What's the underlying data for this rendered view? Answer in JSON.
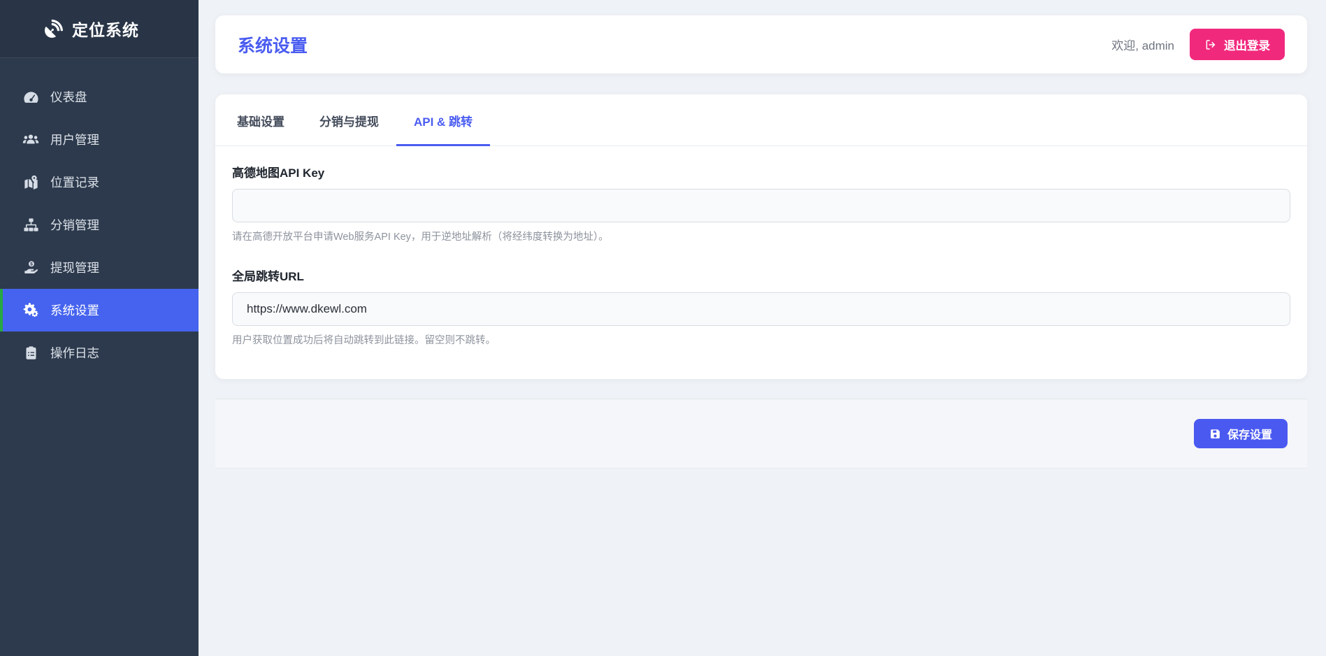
{
  "app": {
    "name": "定位系统",
    "logo_icon": "satellite-dish-icon"
  },
  "sidebar": {
    "items": [
      {
        "label": "仪表盘",
        "icon": "gauge-icon",
        "active": false
      },
      {
        "label": "用户管理",
        "icon": "users-icon",
        "active": false
      },
      {
        "label": "位置记录",
        "icon": "map-marked-icon",
        "active": false
      },
      {
        "label": "分销管理",
        "icon": "sitemap-icon",
        "active": false
      },
      {
        "label": "提现管理",
        "icon": "hand-dollar-icon",
        "active": false
      },
      {
        "label": "系统设置",
        "icon": "gears-icon",
        "active": true
      },
      {
        "label": "操作日志",
        "icon": "clipboard-list-icon",
        "active": false
      }
    ]
  },
  "header": {
    "title": "系统设置",
    "welcome": "欢迎, admin",
    "logout_label": "退出登录",
    "logout_icon": "sign-out-icon"
  },
  "tabs": [
    {
      "label": "基础设置",
      "active": false
    },
    {
      "label": "分销与提现",
      "active": false
    },
    {
      "label": "API & 跳转",
      "active": true
    }
  ],
  "form": {
    "amap": {
      "label": "高德地图API Key",
      "value": "",
      "help": "请在高德开放平台申请Web服务API Key，用于逆地址解析（将经纬度转换为地址）。"
    },
    "redirect": {
      "label": "全局跳转URL",
      "value": "https://www.dkewl.com",
      "help": "用户获取位置成功后将自动跳转到此链接。留空则不跳转。"
    }
  },
  "footer": {
    "save_label": "保存设置",
    "save_icon": "save-icon"
  },
  "colors": {
    "primary": "#4a5cf0",
    "sidebar_active": "#4563ee",
    "accent_green": "#28a745",
    "pink": "#f1297d",
    "sidebar_bg": "#2d3a4d",
    "page_bg": "#eff2f6"
  }
}
